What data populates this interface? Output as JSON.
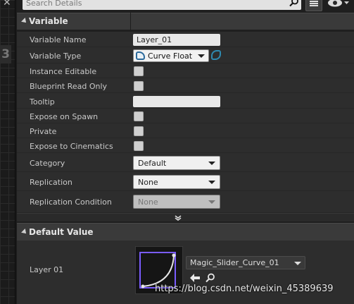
{
  "search": {
    "placeholder": "Search Details"
  },
  "left_strip": {
    "digit": "3"
  },
  "variable_section": {
    "title": "Variable",
    "rows": {
      "variable_name": {
        "label": "Variable Name",
        "value": "Layer_01"
      },
      "variable_type": {
        "label": "Variable Type",
        "value": "Curve Float",
        "icon": "curve-float-type-icon",
        "container_icon": "single-variable-icon"
      },
      "instance_editable": {
        "label": "Instance Editable",
        "checked": false
      },
      "blueprint_read_only": {
        "label": "Blueprint Read Only",
        "checked": false
      },
      "tooltip": {
        "label": "Tooltip",
        "value": ""
      },
      "expose_on_spawn": {
        "label": "Expose on Spawn",
        "checked": false
      },
      "private": {
        "label": "Private",
        "checked": false
      },
      "expose_to_cinematics": {
        "label": "Expose to Cinematics",
        "checked": false
      },
      "category": {
        "label": "Category",
        "value": "Default"
      },
      "replication": {
        "label": "Replication",
        "value": "None"
      },
      "replication_condition": {
        "label": "Replication Condition",
        "value": "None",
        "enabled": false
      }
    }
  },
  "default_value_section": {
    "title": "Default Value",
    "property_label": "Layer 01",
    "asset": "Magic_Slider_Curve_01",
    "thumbnail_icon": "curve-thumbnail-icon"
  },
  "watermark": "https://blog.csdn.net/weixin_45389639",
  "colors": {
    "panel_bg": "#2d2d2d",
    "header_bg": "#3a3a3a",
    "curve_accent": "#7a5cff",
    "type_icon_blue": "#2b6a9c"
  }
}
